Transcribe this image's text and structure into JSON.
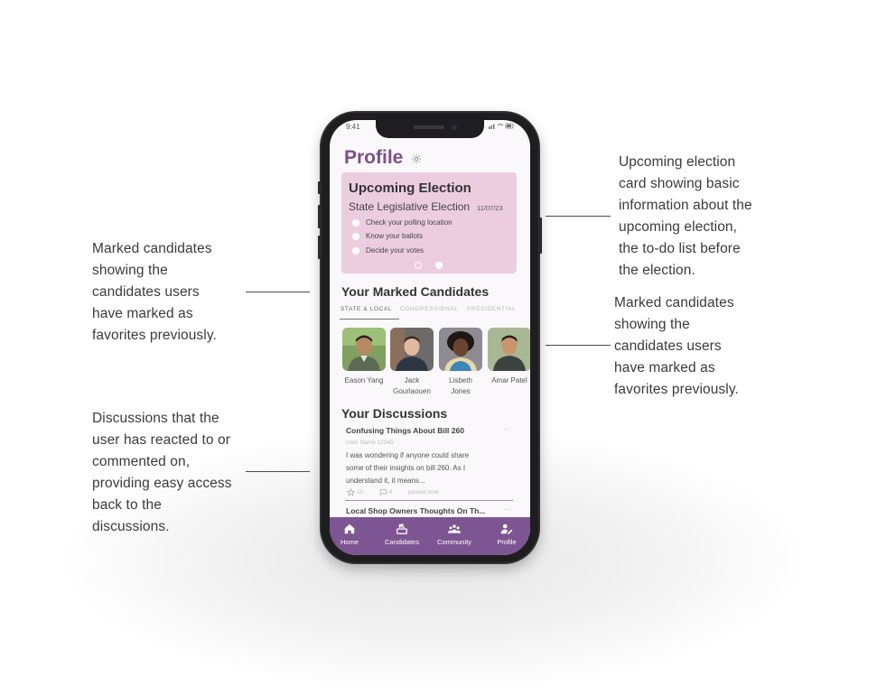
{
  "annotations": {
    "upcoming_election": [
      "Upcoming election",
      "card showing basic",
      "information about the",
      "upcoming election,",
      "the to-do list before",
      "the election."
    ],
    "marked_left": [
      "Marked candidates",
      "showing the",
      "candidates users",
      "have marked as",
      "favorites previously."
    ],
    "marked_right": [
      "Marked candidates",
      "showing the",
      "candidates users",
      "have marked as",
      "favorites previously."
    ],
    "discussions": [
      "Discussions that the",
      "user has reacted to or",
      "commented on,",
      "providing easy access",
      "back to the",
      "discussions."
    ]
  },
  "status_bar": {
    "time": "9:41",
    "icons": "signal-icon wifi-icon battery-icon"
  },
  "header": {
    "title": "Profile",
    "settings_icon": "gear-icon"
  },
  "election_card": {
    "title": "Upcoming Election",
    "subtitle": "State Legislative Election",
    "date": "11/07/23",
    "todos": [
      "Check your polling location",
      "Know your ballots",
      "Decide your votes"
    ],
    "pager": {
      "count": 2,
      "active_index": 1
    }
  },
  "marked_candidates": {
    "title": "Your Marked Candidates",
    "tabs": [
      "STATE & LOCAL",
      "CONGRESSIONAL",
      "PRESIDENTIAL"
    ],
    "active_tab": 0,
    "candidates": [
      {
        "name_line1": "Eason Yang",
        "name_line2": ""
      },
      {
        "name_line1": "Jack",
        "name_line2": "Gourlaouen"
      },
      {
        "name_line1": "Lisbeth",
        "name_line2": "Jones"
      },
      {
        "name_line1": "Amar Patel",
        "name_line2": ""
      }
    ]
  },
  "discussions": {
    "title": "Your Discussions",
    "items": [
      {
        "title": "Confusing Things About Bill 260",
        "user": "User Name 12345",
        "body_lines": [
          "I was wondering if anyone could share",
          "some of their insights on bill 260. As I",
          "understand it, it means..."
        ],
        "likes": "10",
        "comments": "4",
        "time": "posted time",
        "more": "···"
      },
      {
        "title": "Local Shop Owners Thoughts On Th...",
        "more": "···"
      }
    ]
  },
  "nav": [
    {
      "label": "Home",
      "icon": "home-icon"
    },
    {
      "label": "Candidates",
      "icon": "ballot-icon"
    },
    {
      "label": "Community",
      "icon": "community-icon"
    },
    {
      "label": "Profile",
      "icon": "profile-edit-icon"
    }
  ],
  "colors": {
    "brand_purple": "#7d4f8a",
    "navbar": "#7d5592",
    "card_pink": "#eccde0",
    "screen_bg": "#fbf8fb"
  }
}
